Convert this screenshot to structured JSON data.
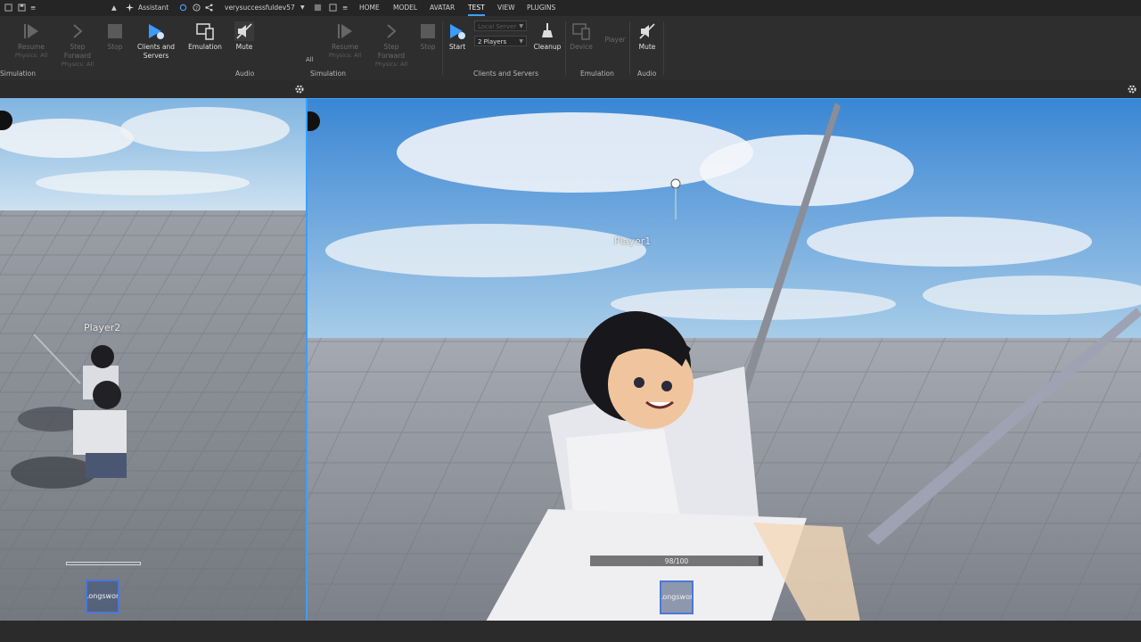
{
  "menubar": {
    "assistant_label": "Assistant",
    "file_name": "verysuccessfuldev57",
    "tabs": [
      "HOME",
      "MODEL",
      "AVATAR",
      "TEST",
      "VIEW",
      "PLUGINS"
    ],
    "active_tab": "TEST"
  },
  "ribbon_left": {
    "resume_label": "Resume",
    "resume_sub": "Physics: All",
    "step_label": "Step Forward",
    "step_sub": "Physics: All",
    "stop_label": "Stop",
    "clients_label_1": "Clients and",
    "clients_label_2": "Servers",
    "emulation_label": "Emulation",
    "mute_label": "Mute",
    "group_simulation": "Simulation",
    "group_audio": "Audio"
  },
  "ribbon_right": {
    "all_fragment": "All",
    "resume_label": "Resume",
    "resume_sub": "Physics: All",
    "step_label": "Step Forward",
    "step_sub": "Physics: All",
    "stop_label": "Stop",
    "start_label": "Start",
    "server_select": "Local Server",
    "players_select": "2 Players",
    "cleanup_label": "Cleanup",
    "device_label": "Device",
    "player_label": "Player",
    "mute_label": "Mute",
    "group_simulation": "Simulation",
    "group_clients": "Clients and Servers",
    "group_emulation": "Emulation",
    "group_audio": "Audio"
  },
  "viewport_left": {
    "nametag": "Player2",
    "hotbar_item": "Longsword"
  },
  "viewport_right": {
    "nametag": "Player1",
    "health_text": "98/100",
    "health_fraction": 0.98,
    "hotbar_item": "Longsword"
  },
  "colors": {
    "accent": "#3aa0ff",
    "sky_top": "#3f8fd8",
    "ground": "#8c9098"
  }
}
